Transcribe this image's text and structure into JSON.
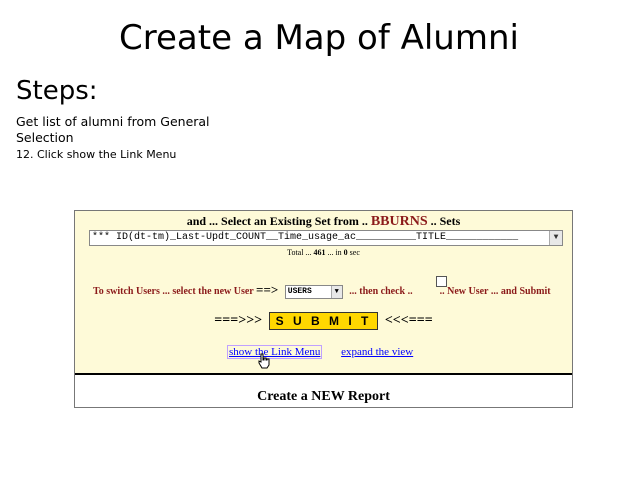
{
  "slide": {
    "title": "Create a Map of Alumni",
    "steps_heading": "Steps:",
    "step_line1": "Get list of alumni from General",
    "step_line2": "Selection",
    "step_line3": "12. Click show the Link Menu"
  },
  "screenshot": {
    "header_prefix": "and ... Select an Existing Set from ..",
    "header_user": "BBURNS",
    "header_suffix": ".. Sets",
    "set_select_value": "*** ID(dt-tm)_Last-Updt_COUNT__Time_usage_ac__________TITLE____________",
    "total_prefix": "Total ...",
    "total_count": "461",
    "total_mid": "... in",
    "total_time": "0",
    "total_suffix": "sec",
    "switch_label": "To switch Users ... select the new User",
    "switch_arrow": "==>",
    "user_select_value": "USERS",
    "then_check": "... then check ..",
    "new_user_text": ".. New User ... and Submit",
    "submit_left": "===>>>",
    "submit_label": "S U B M I T",
    "submit_right": "<<<===",
    "show_link_menu": "show the Link Menu",
    "expand_view": "expand the view",
    "new_report": "Create a NEW Report"
  },
  "icons": {
    "select_arrow": "chevron-down-icon",
    "cursor": "hand-pointer-icon"
  },
  "colors": {
    "background_yellow": "#fefad8",
    "header_red": "#8b1a1a",
    "submit_yellow": "#ffd700",
    "link_blue": "#0000ff"
  }
}
